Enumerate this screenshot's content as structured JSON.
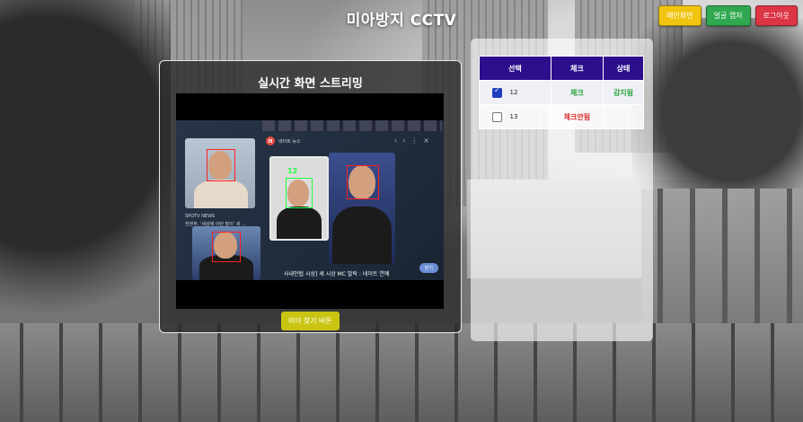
{
  "header": {
    "title": "미아방지 CCTV",
    "buttons": [
      {
        "label": "메인화면",
        "color": "#f1c40f"
      },
      {
        "label": "얼굴 캡처",
        "color": "#2fa84f"
      },
      {
        "label": "로그아웃",
        "color": "#dc3545"
      }
    ]
  },
  "stream": {
    "title": "실시간 화면 스트리밍",
    "find_button": "미아 찾기 버튼",
    "video": {
      "news_source": "네이트 뉴스",
      "detected_id": "12",
      "caption_spotv": "SPOTV NEWS",
      "caption_article": "전현무, '세상에 이런 말이' 세 ...",
      "caption_bottom": "사내안됩 시상] 세 시상 MC 발탁 : 네이트 연예",
      "pill": "닫기"
    }
  },
  "table": {
    "columns": [
      "선택",
      "체크",
      "상태"
    ],
    "rows": [
      {
        "id": "12",
        "checked": true,
        "check": "체크",
        "check_color": "#27a23a",
        "status": "감지됨",
        "status_color": "#27a23a"
      },
      {
        "id": "13",
        "checked": false,
        "check": "체크안됨",
        "check_color": "#d92b2b",
        "status": "",
        "status_color": "#27a23a"
      }
    ]
  }
}
